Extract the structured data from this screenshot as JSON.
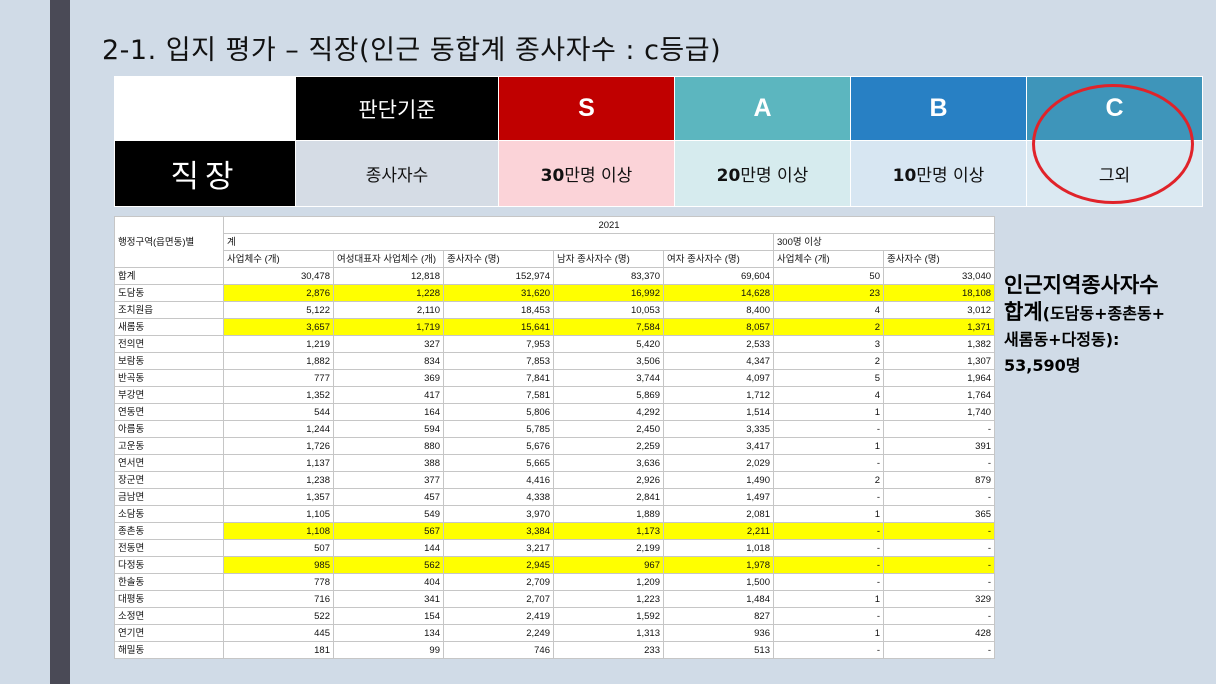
{
  "title": "2-1. 입지 평가 – 직장(인근 동합계 종사자수 : c등급)",
  "criteria": {
    "header_label": "판단기준",
    "grades": [
      "S",
      "A",
      "B",
      "C"
    ],
    "row_label": "직장",
    "basis": "종사자수",
    "values": [
      {
        "num": "30",
        "rest": "만명 이상"
      },
      {
        "num": "20",
        "rest": "만명 이상"
      },
      {
        "num": "10",
        "rest": "만명 이상"
      },
      {
        "num": "",
        "rest": "그외"
      }
    ],
    "colors": {
      "S": "#c00000",
      "A": "#5cb6bf",
      "B": "#2880c4",
      "C": "#3e95ba",
      "highlight": "#ffff00",
      "circle": "#e0232a"
    }
  },
  "sheet": {
    "corner": "행정구역(읍면동)별",
    "year": "2021",
    "group_total": "계",
    "group_300": "300명 이상",
    "columns": [
      "사업체수 (개)",
      "여성대표자 사업체수 (개)",
      "종사자수 (명)",
      "남자 종사자수 (명)",
      "여자 종사자수 (명)",
      "사업체수 (개)",
      "종사자수 (명)"
    ],
    "rows": [
      {
        "name": "합계",
        "v": [
          "30,478",
          "12,818",
          "152,974",
          "83,370",
          "69,604",
          "50",
          "33,040"
        ],
        "hl": false
      },
      {
        "name": "도담동",
        "v": [
          "2,876",
          "1,228",
          "31,620",
          "16,992",
          "14,628",
          "23",
          "18,108"
        ],
        "hl": true
      },
      {
        "name": "조치원읍",
        "v": [
          "5,122",
          "2,110",
          "18,453",
          "10,053",
          "8,400",
          "4",
          "3,012"
        ],
        "hl": false
      },
      {
        "name": "새롬동",
        "v": [
          "3,657",
          "1,719",
          "15,641",
          "7,584",
          "8,057",
          "2",
          "1,371"
        ],
        "hl": true
      },
      {
        "name": "전의면",
        "v": [
          "1,219",
          "327",
          "7,953",
          "5,420",
          "2,533",
          "3",
          "1,382"
        ],
        "hl": false
      },
      {
        "name": "보람동",
        "v": [
          "1,882",
          "834",
          "7,853",
          "3,506",
          "4,347",
          "2",
          "1,307"
        ],
        "hl": false
      },
      {
        "name": "반곡동",
        "v": [
          "777",
          "369",
          "7,841",
          "3,744",
          "4,097",
          "5",
          "1,964"
        ],
        "hl": false
      },
      {
        "name": "부강면",
        "v": [
          "1,352",
          "417",
          "7,581",
          "5,869",
          "1,712",
          "4",
          "1,764"
        ],
        "hl": false
      },
      {
        "name": "연동면",
        "v": [
          "544",
          "164",
          "5,806",
          "4,292",
          "1,514",
          "1",
          "1,740"
        ],
        "hl": false
      },
      {
        "name": "아름동",
        "v": [
          "1,244",
          "594",
          "5,785",
          "2,450",
          "3,335",
          "-",
          "-"
        ],
        "hl": false
      },
      {
        "name": "고운동",
        "v": [
          "1,726",
          "880",
          "5,676",
          "2,259",
          "3,417",
          "1",
          "391"
        ],
        "hl": false
      },
      {
        "name": "연서면",
        "v": [
          "1,137",
          "388",
          "5,665",
          "3,636",
          "2,029",
          "-",
          "-"
        ],
        "hl": false
      },
      {
        "name": "장군면",
        "v": [
          "1,238",
          "377",
          "4,416",
          "2,926",
          "1,490",
          "2",
          "879"
        ],
        "hl": false
      },
      {
        "name": "금남면",
        "v": [
          "1,357",
          "457",
          "4,338",
          "2,841",
          "1,497",
          "-",
          "-"
        ],
        "hl": false
      },
      {
        "name": "소담동",
        "v": [
          "1,105",
          "549",
          "3,970",
          "1,889",
          "2,081",
          "1",
          "365"
        ],
        "hl": false
      },
      {
        "name": "종촌동",
        "v": [
          "1,108",
          "567",
          "3,384",
          "1,173",
          "2,211",
          "-",
          "-"
        ],
        "hl": true
      },
      {
        "name": "전동면",
        "v": [
          "507",
          "144",
          "3,217",
          "2,199",
          "1,018",
          "-",
          "-"
        ],
        "hl": false
      },
      {
        "name": "다정동",
        "v": [
          "985",
          "562",
          "2,945",
          "967",
          "1,978",
          "-",
          "-"
        ],
        "hl": true
      },
      {
        "name": "한솔동",
        "v": [
          "778",
          "404",
          "2,709",
          "1,209",
          "1,500",
          "-",
          "-"
        ],
        "hl": false
      },
      {
        "name": "대평동",
        "v": [
          "716",
          "341",
          "2,707",
          "1,223",
          "1,484",
          "1",
          "329"
        ],
        "hl": false
      },
      {
        "name": "소정면",
        "v": [
          "522",
          "154",
          "2,419",
          "1,592",
          "827",
          "-",
          "-"
        ],
        "hl": false
      },
      {
        "name": "연기면",
        "v": [
          "445",
          "134",
          "2,249",
          "1,313",
          "936",
          "1",
          "428"
        ],
        "hl": false
      },
      {
        "name": "해밀동",
        "v": [
          "181",
          "99",
          "746",
          "233",
          "513",
          "-",
          "-"
        ],
        "hl": false
      }
    ]
  },
  "summary": {
    "line1": "인근지역종사자수",
    "line2_big": "합계",
    "line2_small": "(도담동+종촌동+",
    "line3": "새롬동+다정동):",
    "line4_num": "53,590",
    "line4_unit": "명"
  }
}
